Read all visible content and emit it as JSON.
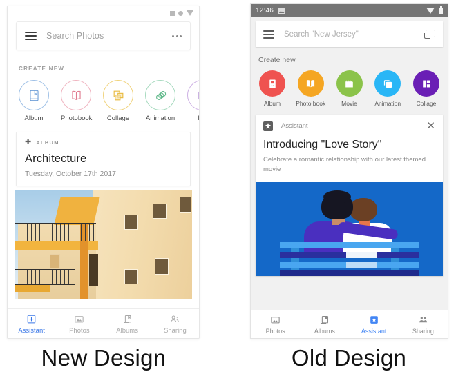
{
  "captions": {
    "new": "New Design",
    "old": "Old Design"
  },
  "new_design": {
    "statusbar": {
      "icons": [
        "square-icon",
        "circle-icon",
        "wifi-triangle-icon"
      ]
    },
    "search": {
      "menu_icon": "hamburger-menu-icon",
      "placeholder": "Search Photos",
      "overflow_icon": "more-options-icon"
    },
    "create_new": {
      "heading": "CREATE NEW",
      "items": [
        {
          "label": "Album",
          "icon": "album-book-icon",
          "color": "#6f9fd8"
        },
        {
          "label": "Photobook",
          "icon": "open-book-icon",
          "color": "#e07b8f"
        },
        {
          "label": "Collage",
          "icon": "collage-icon",
          "color": "#e8b93c"
        },
        {
          "label": "Animation",
          "icon": "animation-icon",
          "color": "#5fb98a"
        },
        {
          "label": "Mo",
          "icon": "movie-icon",
          "color": "#a87fce"
        }
      ]
    },
    "album_card": {
      "kicker_icon": "plus-icon",
      "kicker": "ALBUM",
      "title": "Architecture",
      "date": "Tuesday, October 17th 2017",
      "photo_alt": "yellow-apartment-building-photo"
    },
    "bottom_nav": {
      "active_color": "#3b78e7",
      "inactive_color": "#9e9e9e",
      "items": [
        {
          "label": "Assistant",
          "icon": "assistant-icon",
          "active": true
        },
        {
          "label": "Photos",
          "icon": "photos-icon",
          "active": false
        },
        {
          "label": "Albums",
          "icon": "albums-icon",
          "active": false
        },
        {
          "label": "Sharing",
          "icon": "sharing-icon",
          "active": false
        }
      ]
    }
  },
  "old_design": {
    "statusbar": {
      "time": "12:46",
      "left_icon": "photo-notification-icon",
      "right_icons": [
        "wifi-icon",
        "battery-icon"
      ],
      "background": "#757575"
    },
    "search": {
      "menu_icon": "hamburger-menu-icon",
      "placeholder": "Search \"New Jersey\"",
      "cast_icon": "cast-icon"
    },
    "create_new": {
      "heading": "Create new",
      "items": [
        {
          "label": "Album",
          "icon": "album-icon",
          "color": "#ef5350"
        },
        {
          "label": "Photo book",
          "icon": "photo-book-icon",
          "color": "#f5a623"
        },
        {
          "label": "Movie",
          "icon": "movie-clap-icon",
          "color": "#8bc34a"
        },
        {
          "label": "Animation",
          "icon": "animation-icon",
          "color": "#29b6f6"
        },
        {
          "label": "Collage",
          "icon": "collage-icon",
          "color": "#6a1fb5"
        }
      ]
    },
    "assistant_card": {
      "badge_icon": "assistant-icon",
      "source_label": "Assistant",
      "close_icon": "close-icon",
      "title": "Introducing \"Love Story\"",
      "subtitle": "Celebrate a romantic relationship with our latest themed movie",
      "illustration_alt": "couple-on-bench-illustration",
      "illustration_bg": "#1468c8"
    },
    "bottom_nav": {
      "active_color": "#4285f4",
      "inactive_color": "#8a8a8a",
      "items": [
        {
          "label": "Photos",
          "icon": "photos-icon",
          "active": false
        },
        {
          "label": "Albums",
          "icon": "albums-icon",
          "active": false
        },
        {
          "label": "Assistant",
          "icon": "assistant-icon",
          "active": true
        },
        {
          "label": "Sharing",
          "icon": "sharing-icon",
          "active": false
        }
      ]
    }
  }
}
